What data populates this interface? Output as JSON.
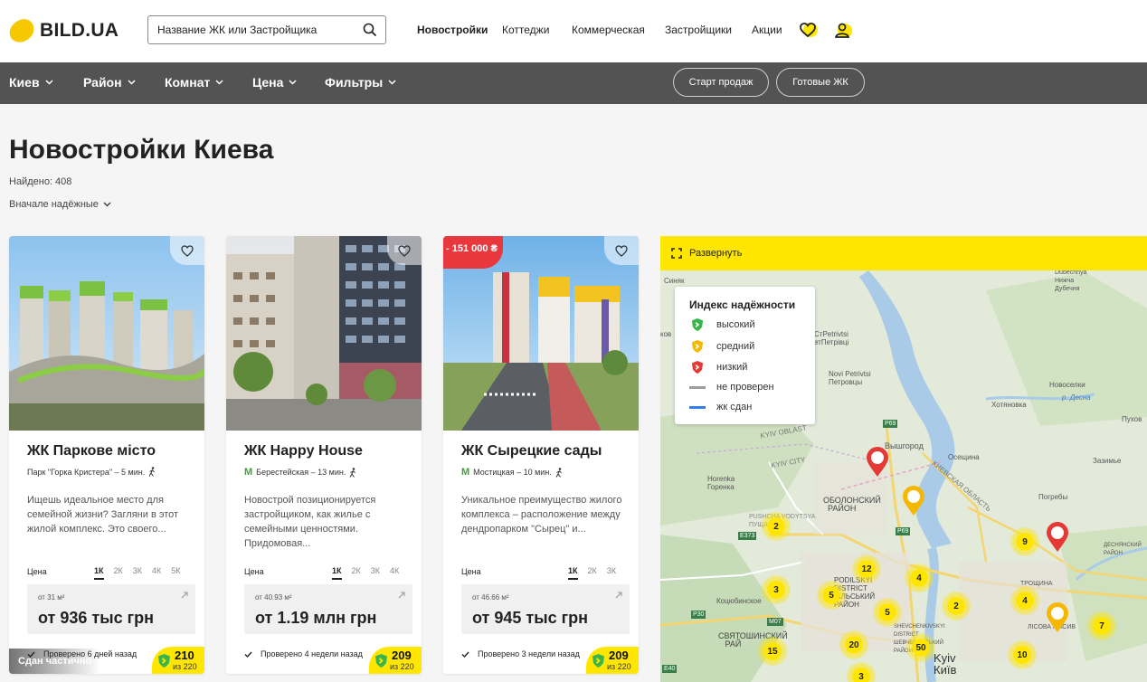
{
  "header": {
    "logo_text": "BILD.UA",
    "search_placeholder": "Название ЖК или Застройщика",
    "nav": [
      "Новостройки",
      "Коттеджи",
      "Коммерческая",
      "Застройщики",
      "Акции"
    ]
  },
  "filters": {
    "items": [
      "Киев",
      "Район",
      "Комнат",
      "Цена",
      "Фильтры"
    ],
    "pills": [
      "Старт продаж",
      "Готовые ЖК"
    ]
  },
  "page": {
    "title": "Новостройки Киева",
    "found": "Найдено: 408",
    "sort": "Вначале надёжные"
  },
  "cards": [
    {
      "status": "Сдан частично",
      "score": "210",
      "score_of": "из 220",
      "name": "ЖК Паркове місто",
      "location": "Парк \"Горка Кристера\"  –  5 мин.",
      "metro": false,
      "description": "Ищешь идеальное место для семейной жизни? Загляни в этот жилой комплекс. Это своего...",
      "price_label": "Цена",
      "rooms": [
        "1К",
        "2К",
        "3К",
        "4К",
        "5К"
      ],
      "from_area": "от 31 м²",
      "price": "от 936 тыс грн",
      "checked": "Проверено 6 дней назад"
    },
    {
      "status": "",
      "score": "209",
      "score_of": "из 220",
      "name": "ЖК Happy House",
      "location": "Берестейская  –  13 мин.",
      "metro": true,
      "description": "Новострой позиционируется застройщиком, как жилье с семейными ценностями. Придомовая...",
      "price_label": "Цена",
      "rooms": [
        "1К",
        "2К",
        "3К",
        "4К"
      ],
      "from_area": "от 40.93 м²",
      "price": "от 1.19 млн грн",
      "checked": "Проверено 4 недели назад"
    },
    {
      "status": "",
      "discount": "- 151 000 ₴",
      "score": "209",
      "score_of": "из 220",
      "name": "ЖК Сырецкие сады",
      "location": "Мостицкая  –  10 мин.",
      "metro": true,
      "description": "Уникальное преимущество жилого комплекса – расположение между дендропарком \"Сырец\" и...",
      "price_label": "Цена",
      "rooms": [
        "1К",
        "2К",
        "3К"
      ],
      "from_area": "от 46.66 м²",
      "price": "от 945 тыс грн",
      "checked": "Проверено 3 недели назад"
    }
  ],
  "map": {
    "expand_label": "Развернуть",
    "legend_title": "Индекс надёжности",
    "legend": [
      "высокий",
      "средний",
      "низкий",
      "не проверен",
      "жк сдан"
    ],
    "legend_colors": [
      "#3ab54a",
      "#f5b800",
      "#e53935",
      "#9e9e9e",
      "#2f80ed"
    ],
    "places": {
      "sinyak": "Синяк",
      "kov": "ков",
      "dubechnya": "Dubechnya\nДубечня",
      "nyzhcha": "Нижча\nДубечня",
      "stpetrivtsi": "СтPetrivtsi\nетПетрівці",
      "novi": "Novi Petrivtsi\nПетровцы",
      "novoselky": "Новоселки",
      "khotianivka": "Хотяновка",
      "pukhov": "Пухов",
      "r_desna": "р. Десна",
      "vyshhorod": "Вышгород",
      "osescina": "Осещина",
      "zazimye": "Зазимье",
      "horenka": "Horenka\nГоренка",
      "pohreby": "Погребы",
      "obolonskyi": "ОБОЛОНСКИЙ\nРАЙОН",
      "kyiv_oblast": "KYIV OBLAST",
      "kyiv_city": "KYIV CITY",
      "podilskyi": "PODILSKYI\nDISTRICT\nДІЛЬСЬКИЙ\nРАЙОН",
      "kotsyubinske": "Коцюбинское",
      "sviatoshynskyi": "СВЯТОШИНСКИЙ\nРАЙ",
      "desnianskyi": "ДЕСНЯНСКИЙ\nРАЙОН",
      "kyiv": "Kyiv\nКиїв",
      "kyivska": "КИЕВСКАЯ ОБЛАСТЬ",
      "pushcha": "PUSHCHA VODYTSYA\nПУЩА",
      "shevchenkivskyi": "SHEVCHENKIVSKYI\nDISTRICT\nШЕВЧЕНКІВСЬКИЙ\nРАЙОН",
      "lisova": "ЛІСОВА МАСИВ",
      "podil": "PODIL",
      "trost": "ТРОЩИНА"
    },
    "roads": [
      "P69",
      "E373",
      "P30",
      "M07",
      "E40",
      "P69"
    ],
    "clusters": [
      "2",
      "12",
      "4",
      "9",
      "3",
      "5",
      "5",
      "2",
      "4",
      "7",
      "15",
      "20",
      "50",
      "10",
      "3"
    ]
  }
}
